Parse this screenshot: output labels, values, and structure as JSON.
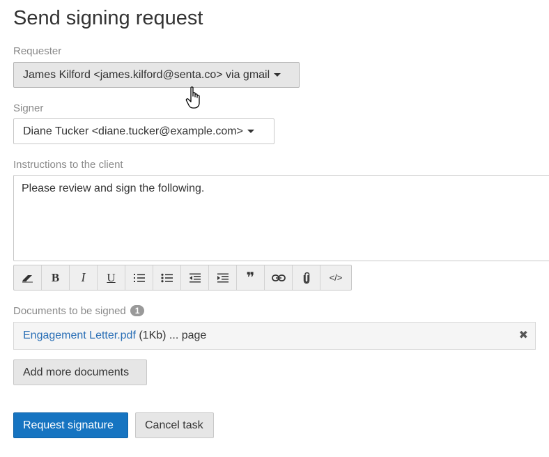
{
  "page": {
    "title": "Send signing request"
  },
  "requester": {
    "label": "Requester",
    "value": "James Kilford <james.kilford@senta.co> via gmail"
  },
  "signer": {
    "label": "Signer",
    "value": "Diane Tucker <diane.tucker@example.com>"
  },
  "instructions": {
    "label": "Instructions to the client",
    "value": "Please review and sign the following."
  },
  "toolbar": {
    "buttons": [
      {
        "name": "clear-format-icon"
      },
      {
        "name": "bold-icon",
        "glyph": "B"
      },
      {
        "name": "italic-icon",
        "glyph": "I"
      },
      {
        "name": "underline-icon",
        "glyph": "U"
      },
      {
        "name": "ordered-list-icon"
      },
      {
        "name": "unordered-list-icon"
      },
      {
        "name": "outdent-icon"
      },
      {
        "name": "indent-icon"
      },
      {
        "name": "blockquote-icon",
        "glyph": "❞"
      },
      {
        "name": "link-icon"
      },
      {
        "name": "attachment-icon"
      },
      {
        "name": "code-icon",
        "glyph": "</>"
      }
    ]
  },
  "documents": {
    "label": "Documents to be signed",
    "count": "1",
    "items": [
      {
        "name": "Engagement Letter.pdf",
        "meta": " (1Kb) ... page",
        "remove": "✖"
      }
    ]
  },
  "buttons": {
    "add_more": "Add more documents",
    "request": "Request signature",
    "cancel": "Cancel task"
  }
}
